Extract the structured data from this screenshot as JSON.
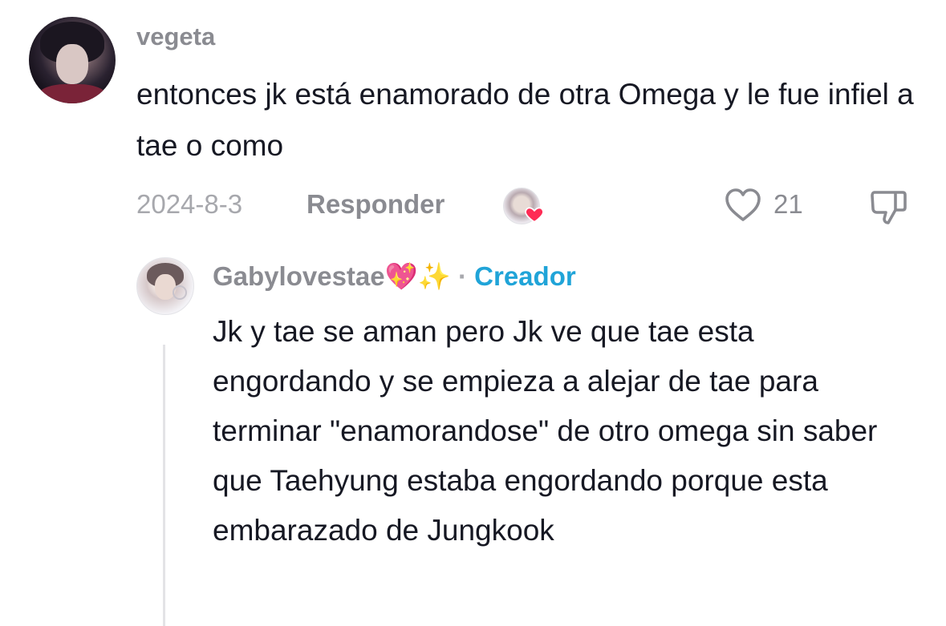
{
  "comment": {
    "username": "vegeta",
    "text": "entonces jk está enamorado de otra Omega y le fue infiel a tae o como",
    "date": "2024-8-3",
    "reply_label": "Responder",
    "like_count": "21",
    "icons": [
      "heart-outline-icon",
      "dislike-icon",
      "creator-liked-heart-icon"
    ]
  },
  "reply": {
    "username": "Gabylovestae",
    "username_emoji_1": "💖",
    "username_emoji_2": "✨",
    "separator": "·",
    "creator_label": "Creador",
    "text": "Jk y tae se aman pero Jk ve que tae esta engordando y se empieza a alejar de tae para terminar \"enamorandose\" de otro omega sin saber que Taehyung estaba engordando porque esta embarazado de Jungkook"
  },
  "colors": {
    "accent_creator": "#20a4d8",
    "heart_red": "#fe2c55",
    "muted_text": "#8a8b91"
  }
}
